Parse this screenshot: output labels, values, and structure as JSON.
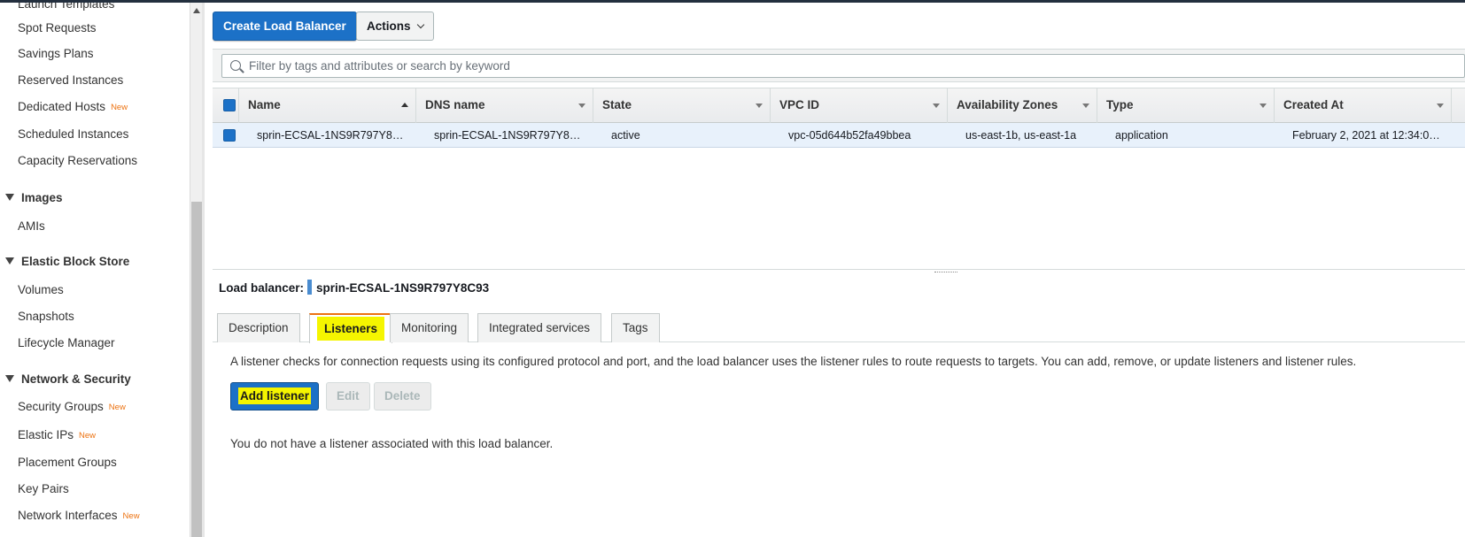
{
  "sidebar": {
    "items": [
      {
        "label": "Launch Templates",
        "new": ""
      },
      {
        "label": "Spot Requests",
        "new": ""
      },
      {
        "label": "Savings Plans",
        "new": ""
      },
      {
        "label": "Reserved Instances",
        "new": ""
      },
      {
        "label": "Dedicated Hosts",
        "new": "New"
      },
      {
        "label": "Scheduled Instances",
        "new": ""
      },
      {
        "label": "Capacity Reservations",
        "new": ""
      }
    ],
    "images_section": "Images",
    "images_items": [
      {
        "label": "AMIs"
      }
    ],
    "ebs_section": "Elastic Block Store",
    "ebs_items": [
      {
        "label": "Volumes"
      },
      {
        "label": "Snapshots"
      },
      {
        "label": "Lifecycle Manager"
      }
    ],
    "network_section": "Network & Security",
    "network_items": [
      {
        "label": "Security Groups",
        "new": "New"
      },
      {
        "label": "Elastic IPs",
        "new": "New"
      },
      {
        "label": "Placement Groups",
        "new": ""
      },
      {
        "label": "Key Pairs",
        "new": ""
      },
      {
        "label": "Network Interfaces",
        "new": "New"
      }
    ]
  },
  "toolbar": {
    "create_label": "Create Load Balancer",
    "actions_label": "Actions"
  },
  "search": {
    "placeholder": "Filter by tags and attributes or search by keyword"
  },
  "table": {
    "columns": [
      "Name",
      "DNS name",
      "State",
      "VPC ID",
      "Availability Zones",
      "Type",
      "Created At"
    ],
    "rows": [
      {
        "name": "sprin-ECSAL-1NS9R797Y8…",
        "dns": "sprin-ECSAL-1NS9R797Y8…",
        "state": "active",
        "vpc": "vpc-05d644b52fa49bbea",
        "zones": "us-east-1b, us-east-1a",
        "type": "application",
        "created": "February 2, 2021 at 12:34:0…"
      }
    ]
  },
  "details": {
    "lb_label": "Load balancer:",
    "lb_name": "sprin-ECSAL-1NS9R797Y8C93",
    "tabs": [
      "Description",
      "Listeners",
      "Monitoring",
      "Integrated services",
      "Tags"
    ],
    "active_tab": "Listeners",
    "description": "A listener checks for connection requests using its configured protocol and port, and the load balancer uses the listener rules to route requests to targets. You can add, remove, or update listeners and listener rules.",
    "add_label": "Add listener",
    "edit_label": "Edit",
    "delete_label": "Delete",
    "empty_message": "You do not have a listener associated with this load balancer."
  },
  "colors": {
    "primary": "#1c71c7",
    "highlight": "#f5f500",
    "tab_accent": "#ec7211",
    "new_badge": "#ec7211"
  }
}
